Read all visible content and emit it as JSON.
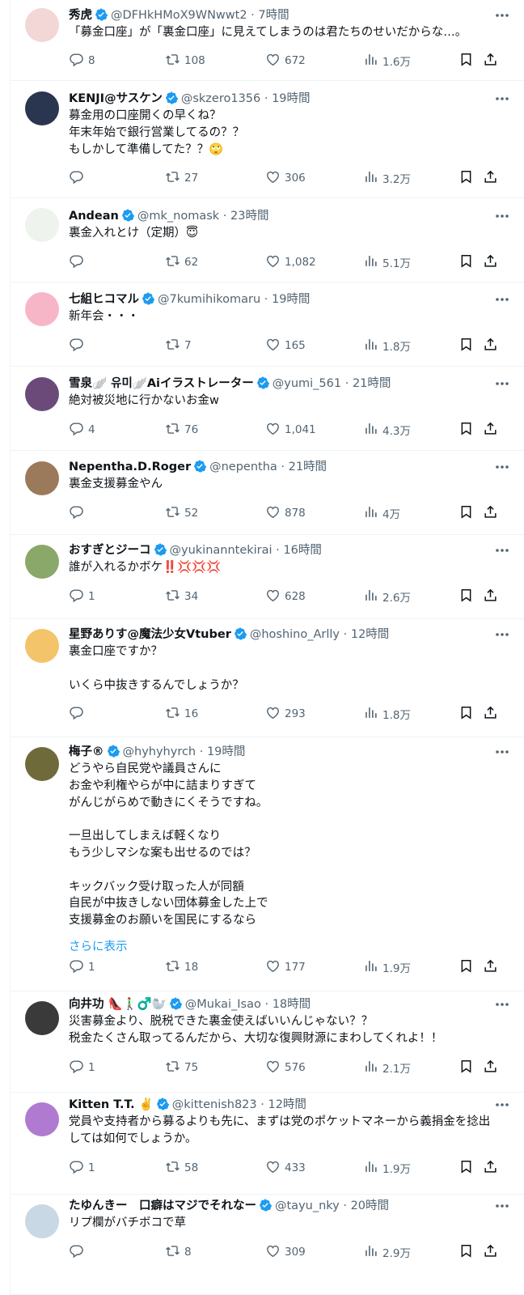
{
  "tweets": [
    {
      "name": "秀虎",
      "handle": "@DFHkHMoX9WNwwt2",
      "time": "7時間",
      "text": "「募金口座」が「裏金口座」に見えてしまうのは君たちのせいだからな…。",
      "show_more": "",
      "replies": "8",
      "retweets": "108",
      "likes": "672",
      "views": "1.6万",
      "avatar_color": "#f3d6d6"
    },
    {
      "name": "KENJI@サスケン",
      "handle": "@skzero1356",
      "time": "19時間",
      "text": "募金用の口座開くの早くね？\n年末年始で銀行営業してるの？？\nもしかして準備してた？？🙄",
      "show_more": "",
      "replies": "",
      "retweets": "27",
      "likes": "306",
      "views": "3.2万",
      "avatar_color": "#2a3550"
    },
    {
      "name": "Andean",
      "handle": "@mk_nomask",
      "time": "23時間",
      "text": "裏金入れとけ（定期）😇",
      "show_more": "",
      "replies": "",
      "retweets": "62",
      "likes": "1,082",
      "views": "5.1万",
      "avatar_color": "#eef3ee"
    },
    {
      "name": "七組ヒコマル",
      "handle": "@7kumihikomaru",
      "time": "19時間",
      "text": "新年会・・・",
      "show_more": "",
      "replies": "",
      "retweets": "7",
      "likes": "165",
      "views": "1.8万",
      "avatar_color": "#f7b6c8"
    },
    {
      "name": "雪泉🪽 유미🪽Aiイラストレーター",
      "handle": "@yumi_561",
      "time": "21時間",
      "text": "絶対被災地に行かないお金w",
      "show_more": "",
      "replies": "4",
      "retweets": "76",
      "likes": "1,041",
      "views": "4.3万",
      "avatar_color": "#6b4a7a"
    },
    {
      "name": "Nepentha.D.Roger",
      "handle": "@nepentha",
      "time": "21時間",
      "text": "裏金支援募金やん",
      "show_more": "",
      "replies": "",
      "retweets": "52",
      "likes": "878",
      "views": "4万",
      "avatar_color": "#9a7a5a"
    },
    {
      "name": "おすぎとジーコ",
      "handle": "@yukinanntekirai",
      "time": "16時間",
      "text": "誰が入れるかボケ‼️💢💢💢",
      "show_more": "",
      "replies": "1",
      "retweets": "34",
      "likes": "628",
      "views": "2.6万",
      "avatar_color": "#8aa86a"
    },
    {
      "name": "星野ありす@魔法少女Vtuber",
      "handle": "@hoshino_Arlly",
      "time": "12時間",
      "text": "裏金口座ですか？\n\nいくら中抜きするんでしょうか？",
      "show_more": "",
      "replies": "",
      "retweets": "16",
      "likes": "293",
      "views": "1.8万",
      "avatar_color": "#f4c46a"
    },
    {
      "name": "梅子®",
      "handle": "@hyhyhyrch",
      "time": "19時間",
      "text": "どうやら自民党や議員さんに\nお金や利権やらが中に詰まりすぎて\nがんじがらめで動きにくそうですね。\n\n一旦出してしまえば軽くなり\nもう少しマシな案も出せるのでは？\n\nキックバック受け取った人が同額\n自民が中抜きしない団体募金した上で\n支援募金のお願いを国民にするなら",
      "show_more": "さらに表示",
      "replies": "1",
      "retweets": "18",
      "likes": "177",
      "views": "1.9万",
      "avatar_color": "#6f6a3a"
    },
    {
      "name": "向井功 👠🚶‍♂️♂️🦭",
      "handle": "@Mukai_Isao",
      "time": "18時間",
      "text": "災害募金より、脱税できた裏金使えばいいんじゃない？？\n税金たくさん取ってるんだから、大切な復興財源にまわしてくれよ！！",
      "show_more": "",
      "replies": "1",
      "retweets": "75",
      "likes": "576",
      "views": "2.1万",
      "avatar_color": "#3a3a3a"
    },
    {
      "name": "Kitten T.T. ✌️",
      "handle": "@kittenish823",
      "time": "12時間",
      "text": "党員や支持者から募るよりも先に、まずは党のポケットマネーから義捐金を捻出\nしては如何でしょうか。",
      "show_more": "",
      "replies": "1",
      "retweets": "58",
      "likes": "433",
      "views": "1.9万",
      "avatar_color": "#b07ad0"
    },
    {
      "name": "たゆんきー　口癖はマジでそれなー",
      "handle": "@tayu_nky",
      "time": "20時間",
      "text": "リプ欄がバチボコで草",
      "show_more": "",
      "replies": "",
      "retweets": "8",
      "likes": "309",
      "views": "2.9万",
      "avatar_color": "#c8d8e4"
    }
  ],
  "colors": {
    "secondary_text": "#536471",
    "verified": "#1d9bf0",
    "link": "#1d9bf0",
    "divider": "#eff3f4"
  },
  "icons": [
    "verified-badge-icon",
    "more-icon",
    "reply-icon",
    "retweet-icon",
    "like-icon",
    "views-icon",
    "bookmark-icon",
    "share-icon"
  ]
}
